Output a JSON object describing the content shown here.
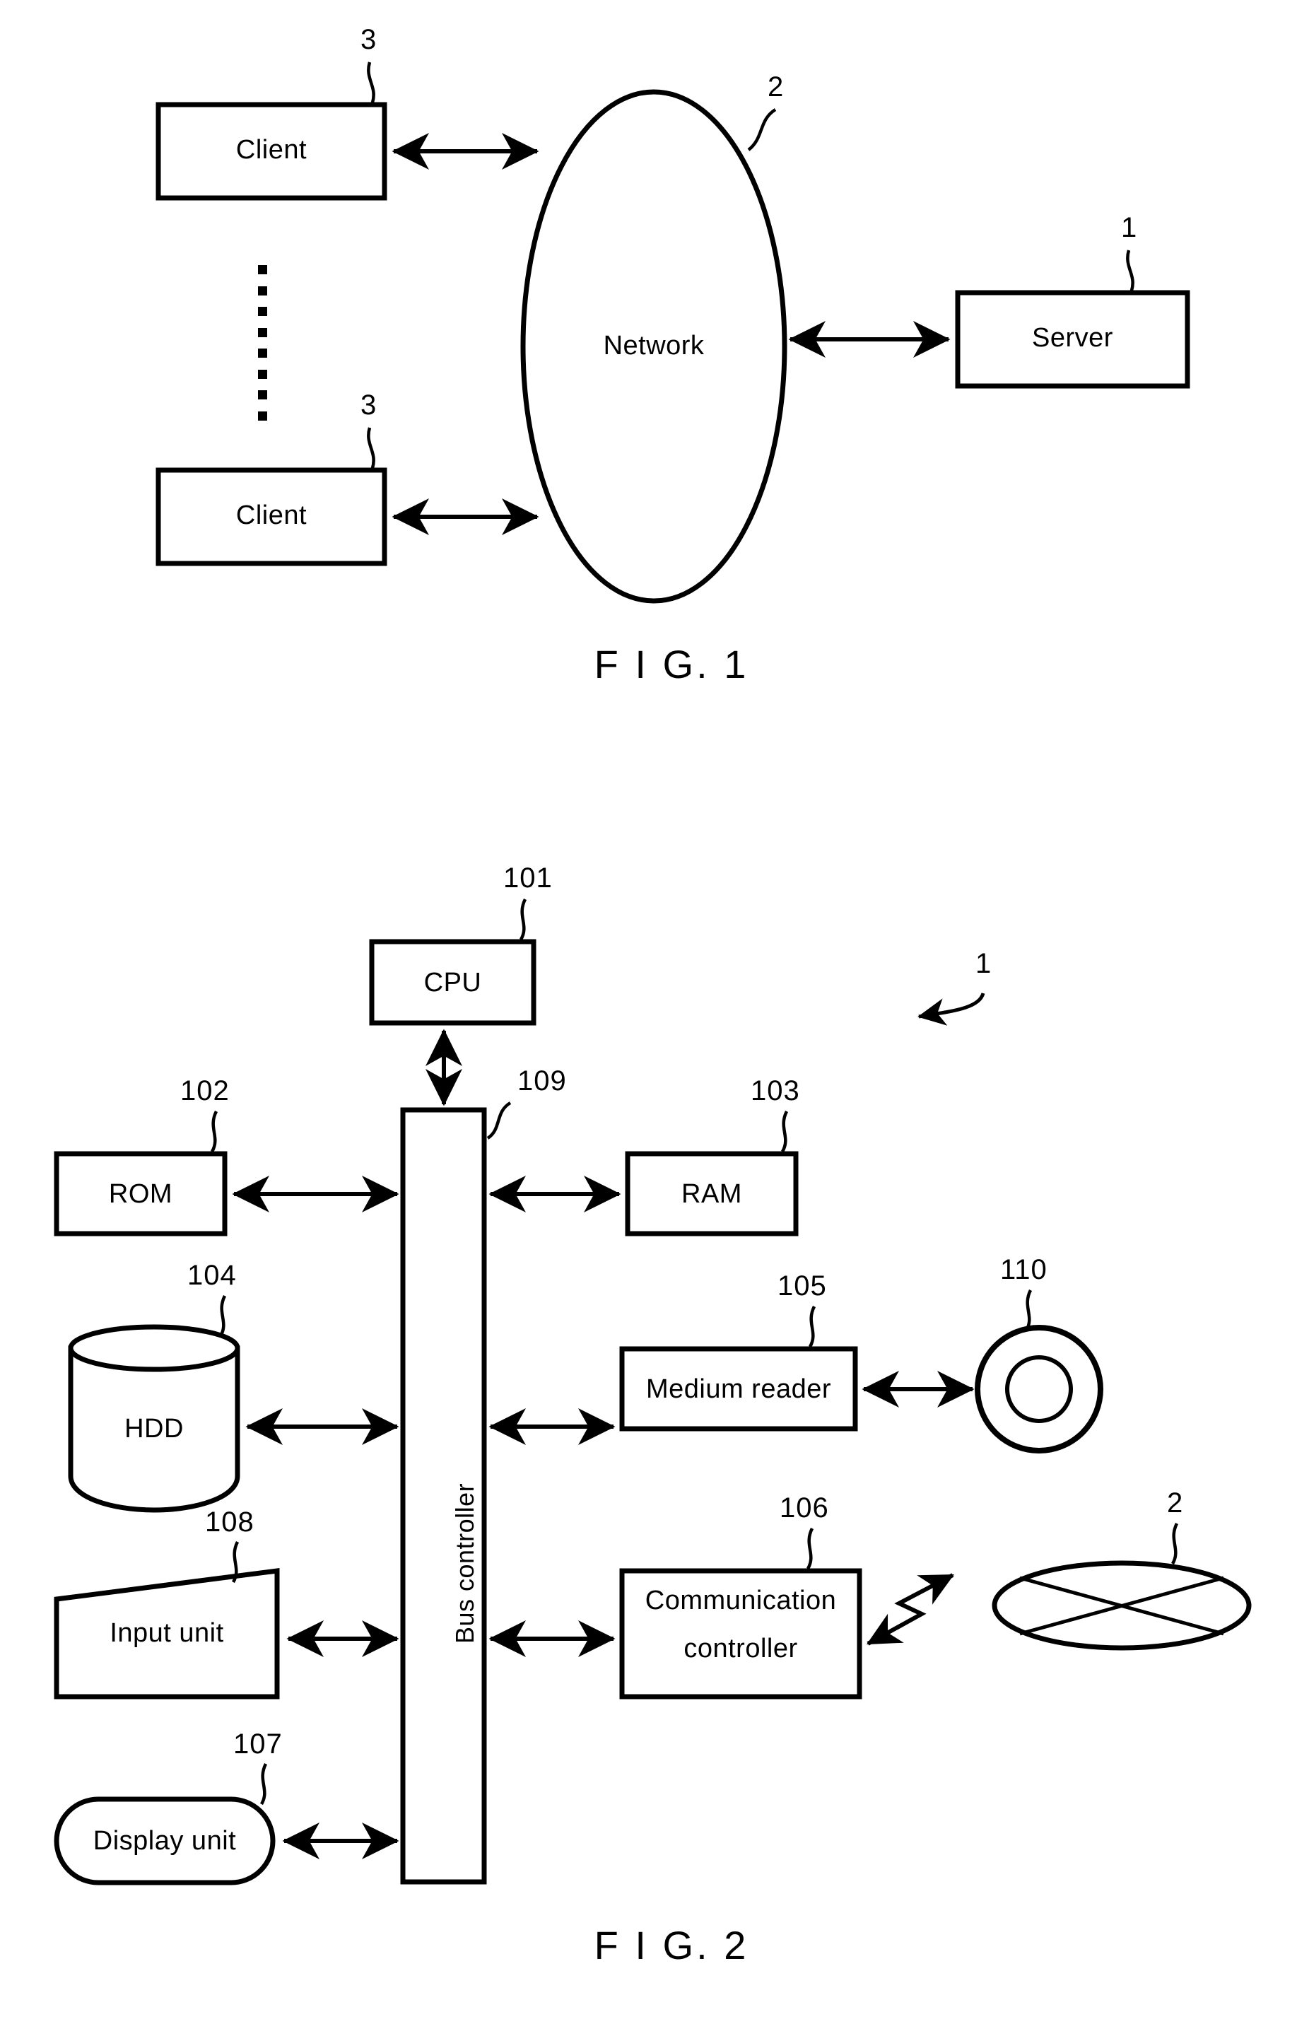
{
  "document": {
    "type": "patent-drawing-sheet",
    "background_color": "#ffffff",
    "stroke_color": "#000000"
  },
  "figure1": {
    "caption": "F I G. 1",
    "nodes": {
      "client_top": {
        "label": "Client",
        "ref": "3"
      },
      "client_bottom": {
        "label": "Client",
        "ref": "3"
      },
      "network": {
        "label": "Network",
        "ref": "2"
      },
      "server": {
        "label": "Server",
        "ref": "1"
      }
    },
    "ellipsis": "vertical-dots",
    "connections": [
      {
        "from": "client_top",
        "to": "network",
        "style": "double-arrow"
      },
      {
        "from": "client_bottom",
        "to": "network",
        "style": "double-arrow"
      },
      {
        "from": "network",
        "to": "server",
        "style": "double-arrow"
      }
    ]
  },
  "figure2": {
    "caption": "F I G. 2",
    "system_ref": "1",
    "nodes": {
      "cpu": {
        "label": "CPU",
        "ref": "101"
      },
      "rom": {
        "label": "ROM",
        "ref": "102"
      },
      "ram": {
        "label": "RAM",
        "ref": "103"
      },
      "hdd": {
        "label": "HDD",
        "ref": "104"
      },
      "medium_reader": {
        "label": "Medium  reader",
        "ref": "105"
      },
      "communication_controller": {
        "label_line1": "Communication",
        "label_line2": "controller",
        "ref": "106"
      },
      "display_unit": {
        "label": "Display  unit",
        "ref": "107"
      },
      "input_unit": {
        "label": "Input  unit",
        "ref": "108"
      },
      "bus_controller": {
        "label": "Bus controller",
        "ref": "109"
      },
      "storage_medium": {
        "label": "",
        "ref": "110"
      },
      "network": {
        "label": "",
        "ref": "2"
      }
    },
    "connections": [
      {
        "from": "cpu",
        "to": "bus_controller",
        "style": "double-arrow"
      },
      {
        "from": "rom",
        "to": "bus_controller",
        "style": "double-arrow"
      },
      {
        "from": "bus_controller",
        "to": "ram",
        "style": "double-arrow"
      },
      {
        "from": "hdd",
        "to": "bus_controller",
        "style": "double-arrow"
      },
      {
        "from": "bus_controller",
        "to": "medium_reader",
        "style": "double-arrow"
      },
      {
        "from": "medium_reader",
        "to": "storage_medium",
        "style": "double-arrow"
      },
      {
        "from": "input_unit",
        "to": "bus_controller",
        "style": "double-arrow"
      },
      {
        "from": "bus_controller",
        "to": "communication_controller",
        "style": "double-arrow"
      },
      {
        "from": "communication_controller",
        "to": "network",
        "style": "wireless-lightning-double-arrow"
      },
      {
        "from": "display_unit",
        "to": "bus_controller",
        "style": "double-arrow"
      }
    ]
  }
}
